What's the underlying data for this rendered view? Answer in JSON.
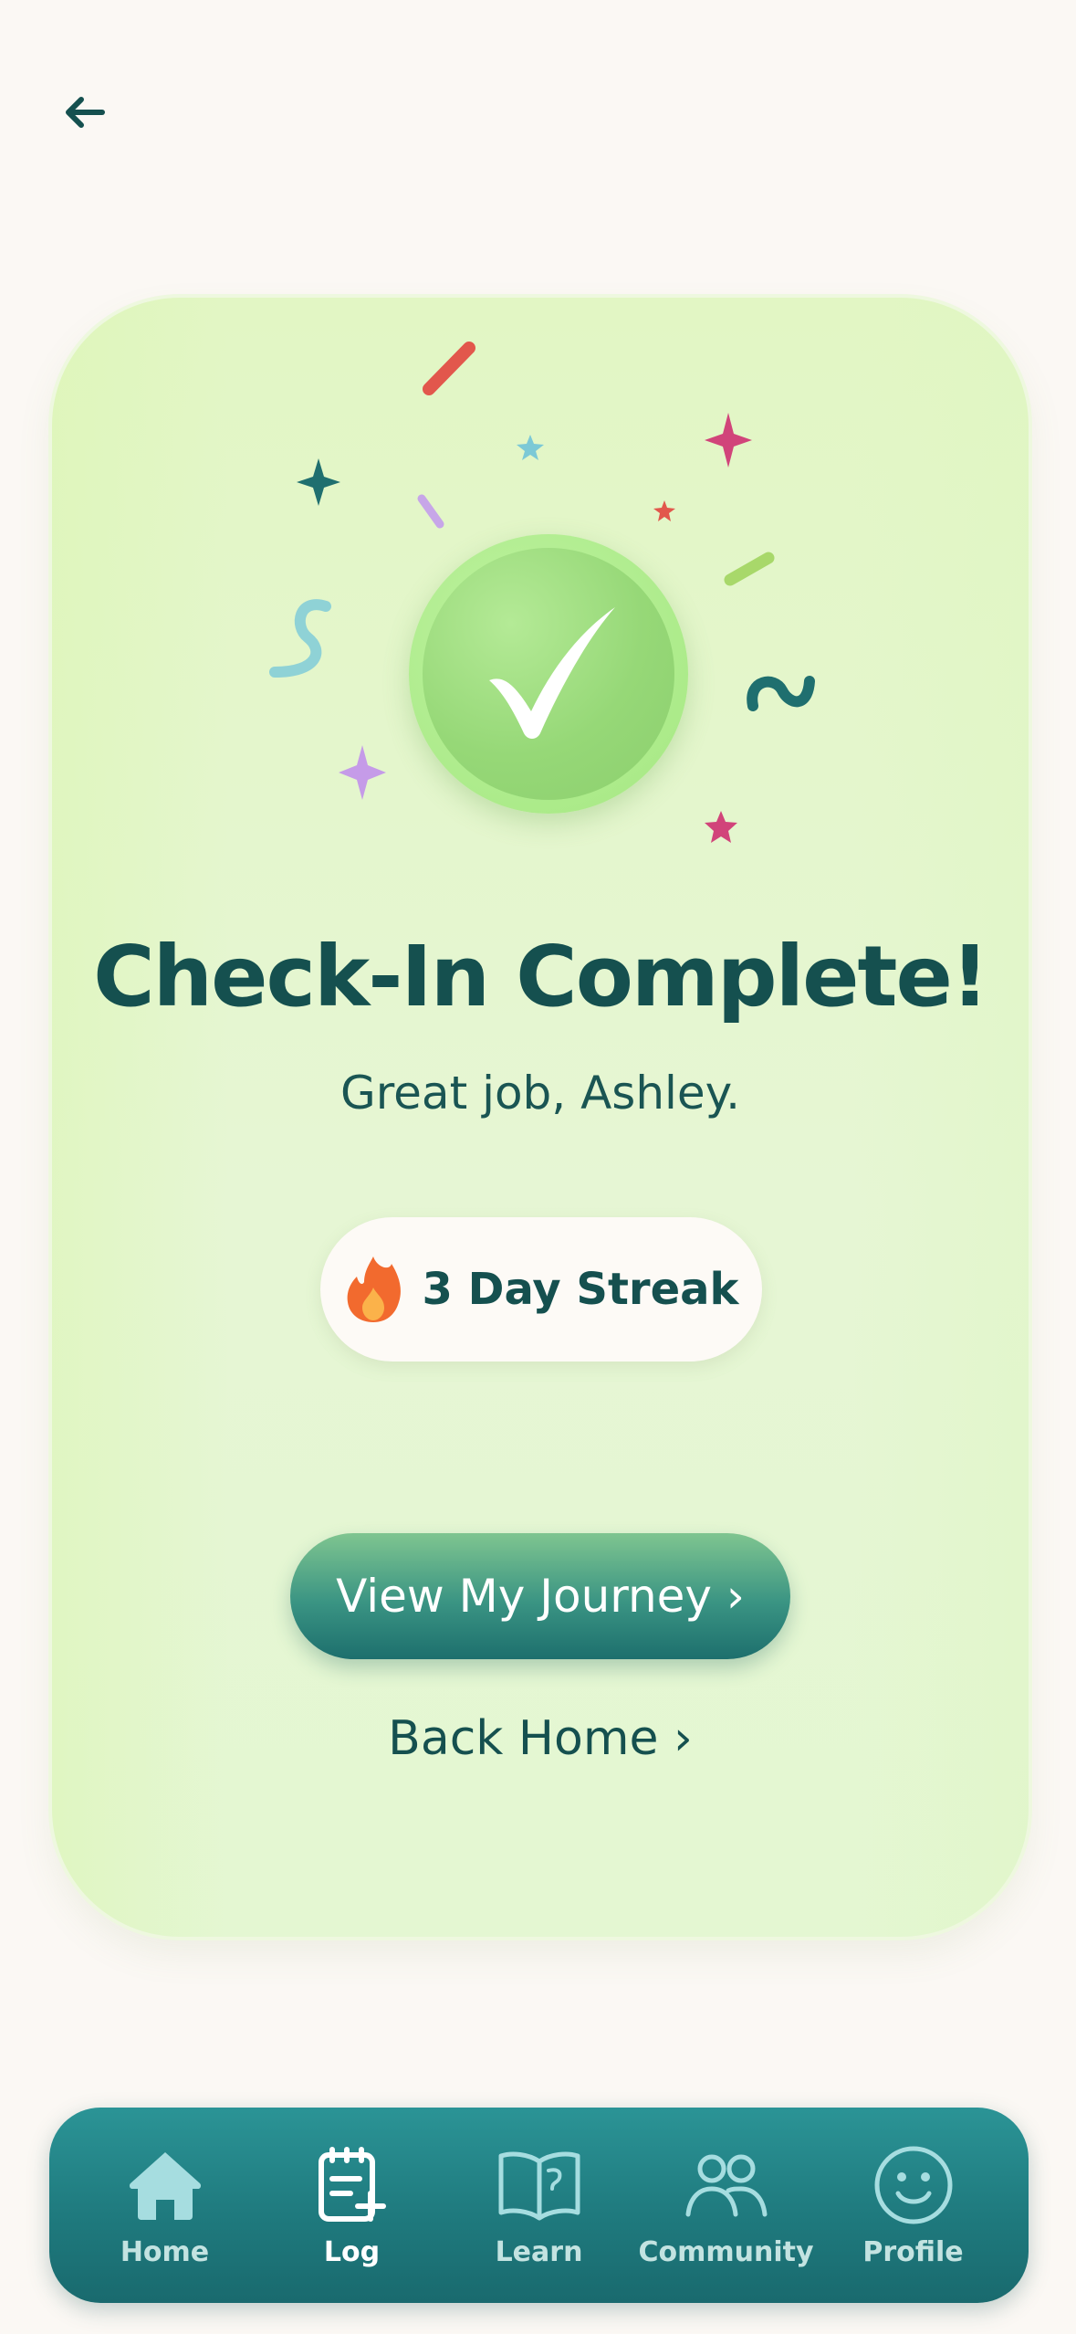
{
  "header": {
    "back_icon": "arrow-left-icon"
  },
  "card": {
    "check_icon": "checkmark-icon",
    "title": "Check-In Complete!",
    "subtitle": "Great job, Ashley.",
    "streak": {
      "icon": "flame-icon",
      "label": "3 Day Streak"
    },
    "primary_button_label": "View My Journey ›",
    "secondary_link_label": "Back Home ›"
  },
  "tabbar": {
    "active": "Log",
    "items": [
      {
        "label": "Home",
        "icon": "home-icon"
      },
      {
        "label": "Log",
        "icon": "log-notepad-icon"
      },
      {
        "label": "Learn",
        "icon": "book-icon"
      },
      {
        "label": "Community",
        "icon": "people-icon"
      },
      {
        "label": "Profile",
        "icon": "smiley-face-icon"
      }
    ]
  },
  "colors": {
    "background": "#fbf8f4",
    "card": "#e4f6d2",
    "text_primary": "#15504f",
    "check_green": "#9bdc7c",
    "button_teal": "#1d6f6d",
    "tabbar_teal": "#1f7a7e",
    "flame": "#f26a2e"
  }
}
